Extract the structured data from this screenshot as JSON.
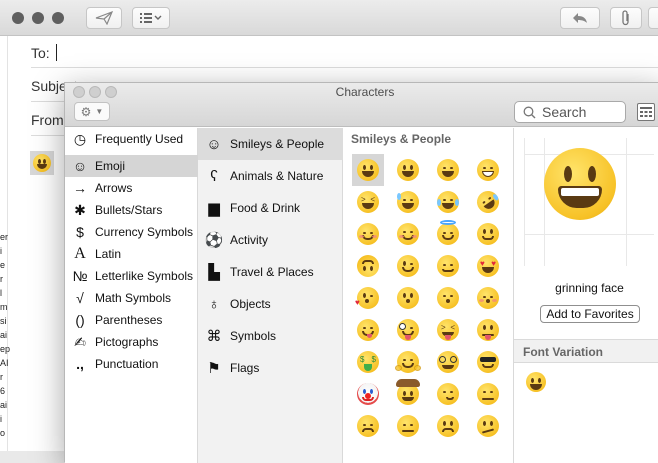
{
  "mail": {
    "to_label": "To:",
    "subject_label": "Subject:",
    "from_label": "From:",
    "edge_text": [
      "er",
      "i",
      "e",
      "r",
      "l",
      "m",
      "si",
      "ai",
      "ep",
      "AI",
      "r",
      "6",
      "ai",
      "i",
      "o"
    ]
  },
  "characters": {
    "title": "Characters",
    "search": {
      "placeholder": "Search"
    },
    "categories": [
      {
        "label": "Frequently Used",
        "icon": "clock-icon",
        "glyph": "◷"
      },
      {
        "label": "Emoji",
        "icon": "smiley-icon",
        "glyph": "☺"
      },
      {
        "label": "Arrows",
        "icon": "arrow-icon",
        "glyph": "→"
      },
      {
        "label": "Bullets/Stars",
        "icon": "asterisk-icon",
        "glyph": "✱"
      },
      {
        "label": "Currency Symbols",
        "icon": "dollar-icon",
        "glyph": "$"
      },
      {
        "label": "Latin",
        "icon": "latin-a-icon",
        "glyph": "A"
      },
      {
        "label": "Letterlike Symbols",
        "icon": "numero-icon",
        "glyph": "№"
      },
      {
        "label": "Math Symbols",
        "icon": "square-root-icon",
        "glyph": "√"
      },
      {
        "label": "Parentheses",
        "icon": "parentheses-icon",
        "glyph": "()"
      },
      {
        "label": "Pictographs",
        "icon": "pencil-icon",
        "glyph": "✍"
      },
      {
        "label": "Punctuation",
        "icon": "punctuation-icon",
        "glyph": ".,"
      }
    ],
    "subcategories": [
      {
        "label": "Smileys & People",
        "icon": "smiley-icon",
        "glyph": "☺"
      },
      {
        "label": "Animals & Nature",
        "icon": "bear-icon",
        "glyph": "☘"
      },
      {
        "label": "Food & Drink",
        "icon": "cake-icon",
        "glyph": "☕"
      },
      {
        "label": "Activity",
        "icon": "soccer-ball-icon",
        "glyph": "⚽"
      },
      {
        "label": "Travel & Places",
        "icon": "bus-icon",
        "glyph": "✈"
      },
      {
        "label": "Objects",
        "icon": "lightbulb-icon",
        "glyph": "☀"
      },
      {
        "label": "Symbols",
        "icon": "symbols-icon",
        "glyph": "⌘"
      },
      {
        "label": "Flags",
        "icon": "flag-icon",
        "glyph": "⚑"
      }
    ],
    "grid_header": "Smileys & People",
    "selected_character": {
      "name": "grinning face",
      "favorites_button": "Add to Favorites"
    },
    "font_variation_header": "Font Variation"
  }
}
